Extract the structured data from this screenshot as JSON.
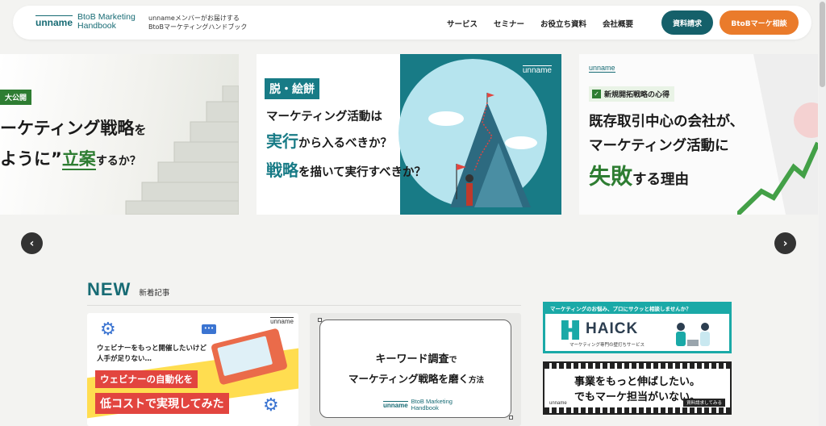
{
  "header": {
    "logo_mark": "unname",
    "logo_title_line1": "BtoB Marketing",
    "logo_title_line2": "Handbook",
    "tagline_line1": "unnameメンバーがお届けする",
    "tagline_line2": "BtoBマーケティングハンドブック",
    "nav": [
      "サービス",
      "セミナー",
      "お役立ち資料",
      "会社概要"
    ],
    "cta_request": "資料請求",
    "cta_consult": "BtoBマーケ相談"
  },
  "carousel": {
    "slide1": {
      "badge": "大公開",
      "line1_a": "ーケティング戦略",
      "line1_b": "を",
      "line2_a": "ように”",
      "line2_b": "立案",
      "line2_c": "するか？"
    },
    "slide2": {
      "logo": "unname",
      "badge": "脱・絵餅",
      "line1": "マーケティング活動は",
      "line2_hl": "実行",
      "line2": "から入るべきか？",
      "line3_hl": "戦略",
      "line3": "を描いて実行すべきか？"
    },
    "slide3": {
      "logo": "unname",
      "badge": "新規開拓戦略の心得",
      "line1": "既存取引中心の会社が、",
      "line2": "マーケティング活動に",
      "line3_hl": "失敗",
      "line3": "する理由"
    },
    "prev_label": "‹",
    "next_label": "›"
  },
  "new_section": {
    "title_en": "NEW",
    "title_ja": "新着記事"
  },
  "cards": [
    {
      "logo": "unname",
      "sub1": "ウェビナーをもっと開催したいけど",
      "sub2": "人手が足りない…",
      "band1": "ウェビナーの自動化を",
      "band2": "低コストで実現してみた"
    },
    {
      "line1_a": "キーワード調査",
      "line1_b": "で",
      "line2_a": "マーケティング戦略を磨く",
      "line2_b": "方法",
      "logo_mark": "unname",
      "logo_line1": "BtoB Marketing",
      "logo_line2": "Handbook"
    }
  ],
  "ads": {
    "haick": {
      "top": "マーケティングのお悩み、プロにサクッと相談しませんか？",
      "logo": "HAICK",
      "sub": "マーケティング専門の壁打ちサービス"
    },
    "unname": {
      "line1": "事業をもっと伸ばしたい。",
      "line2": "でもマーケ担当がいない。",
      "logo": "unname",
      "button": "資料請求してみる"
    }
  },
  "colors": {
    "brand_teal": "#176b74",
    "cta_orange": "#ea7b2b",
    "accent_green": "#2e7d32",
    "accent_red": "#e2453f",
    "haick_teal": "#1aa9a7"
  }
}
